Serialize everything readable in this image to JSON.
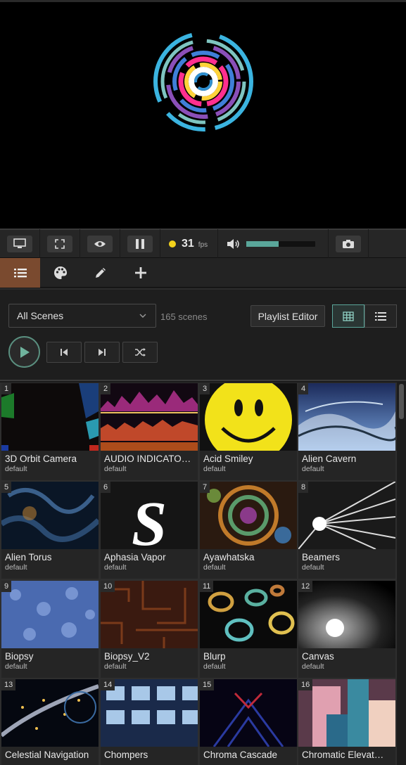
{
  "controls": {
    "fps_value": "31",
    "fps_unit": "fps",
    "volume_level": 0.47,
    "colors": {
      "fps_dot": "#f2d21c",
      "volume_fill": "#5aa69a",
      "accent_tab": "#7a4a2f"
    }
  },
  "tabs": [
    {
      "name": "list-icon",
      "active": true
    },
    {
      "name": "palette-icon",
      "active": false
    },
    {
      "name": "pencil-icon",
      "active": false
    },
    {
      "name": "plus-icon",
      "active": false
    }
  ],
  "playlist": {
    "selected": "All Scenes",
    "count": "165 scenes",
    "editor_label": "Playlist Editor",
    "view_mode": "grid"
  },
  "scenes": [
    {
      "num": "1",
      "name": "3D Orbit Camera",
      "playlist": "default"
    },
    {
      "num": "2",
      "name": "AUDIO INDICATO…",
      "playlist": "default"
    },
    {
      "num": "3",
      "name": "Acid Smiley",
      "playlist": "default"
    },
    {
      "num": "4",
      "name": "Alien Cavern",
      "playlist": "default"
    },
    {
      "num": "5",
      "name": "Alien Torus",
      "playlist": "default"
    },
    {
      "num": "6",
      "name": "Aphasia Vapor",
      "playlist": "default"
    },
    {
      "num": "7",
      "name": "Ayawhatska",
      "playlist": "default"
    },
    {
      "num": "8",
      "name": "Beamers",
      "playlist": "default"
    },
    {
      "num": "9",
      "name": "Biopsy",
      "playlist": "default"
    },
    {
      "num": "10",
      "name": "Biopsy_V2",
      "playlist": "default"
    },
    {
      "num": "11",
      "name": "Blurp",
      "playlist": "default"
    },
    {
      "num": "12",
      "name": "Canvas",
      "playlist": "default"
    },
    {
      "num": "13",
      "name": "Celestial Navigation",
      "playlist": ""
    },
    {
      "num": "14",
      "name": "Chompers",
      "playlist": ""
    },
    {
      "num": "15",
      "name": "Chroma Cascade",
      "playlist": ""
    },
    {
      "num": "16",
      "name": "Chromatic Elevat…",
      "playlist": ""
    }
  ]
}
